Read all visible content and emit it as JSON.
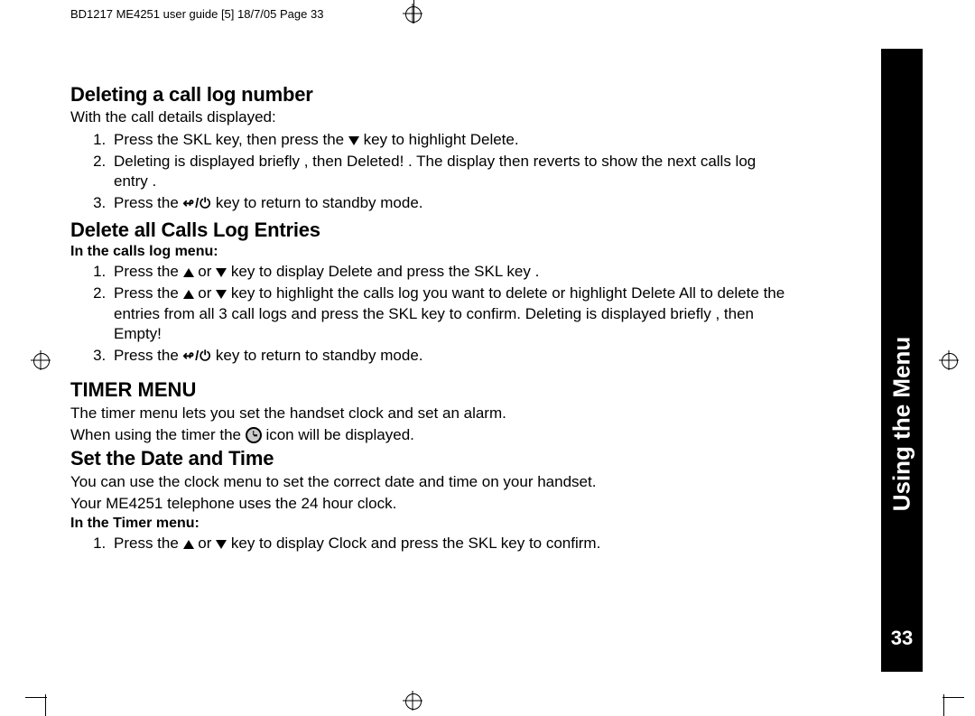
{
  "meta": {
    "headerText": "BD1217 ME4251 user guide [5]  18/7/05  Page 33"
  },
  "sideTab": {
    "label": "Using the Menu",
    "pageNumber": "33"
  },
  "s1": {
    "title": "Deleting a call log number",
    "intro": "With the call details displayed:",
    "li1a": "Press the  SKL key, then press the ",
    "li1b": " key to highlight Delete.",
    "li2": "Deleting  is displayed briefly , then Deleted! . The display then reverts to show the next calls log entry .",
    "li3a": "Press the ",
    "li3b": " key to return to standby mode."
  },
  "s2": {
    "title": "Delete all Calls Log Entries",
    "sub": "In the calls log menu:",
    "li1a": "Press the ",
    "li1b": " or ",
    "li1c": " key to display Delete  and press the  SKL key .",
    "li2a": "Press the ",
    "li2b": " or ",
    "li2c": " key to highlight the calls log you want to delete or highlight Delete All  to delete the entries from all 3 call logs and press the  SKL key to confirm. Deleting  is displayed briefly , then Empty!",
    "li3a": "Press the ",
    "li3b": " key to return to standby mode."
  },
  "s3": {
    "title": "TIMER MENU",
    "p1": "The timer menu lets you set the handset clock and set an alarm.",
    "p2a": "When using the timer the ",
    "p2b": " icon will be displayed."
  },
  "s4": {
    "title": "Set the Date and Time",
    "p1": "You can use the clock menu to set the correct date and time on your handset.",
    "p2": "Your ME4251 telephone uses the 24 hour clock.",
    "sub": "In the Timer menu:",
    "li1a": "Press the ",
    "li1b": " or ",
    "li1c": " key to display Clock  and press the  SKL key to confirm."
  }
}
